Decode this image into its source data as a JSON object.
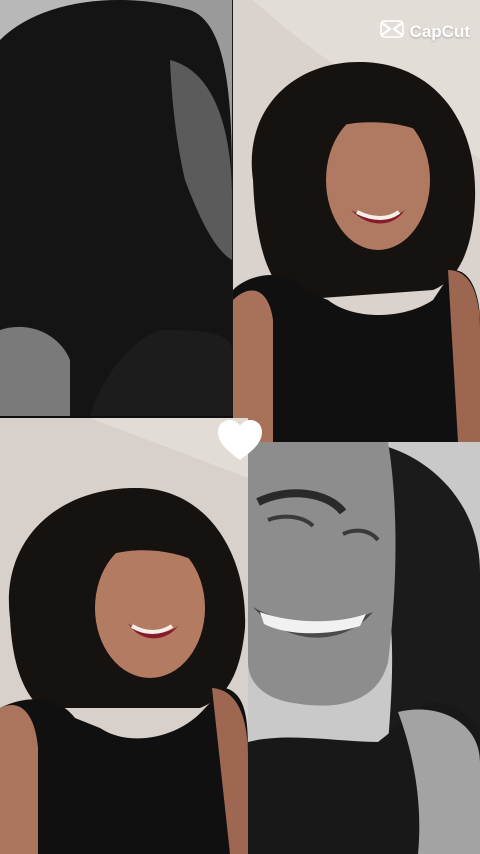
{
  "watermark": {
    "label": "CapCut",
    "icon": "capcut-logo-icon"
  },
  "tiles": [
    {
      "name": "photo-top-left",
      "tone": "grayscale"
    },
    {
      "name": "photo-top-right",
      "tone": "color"
    },
    {
      "name": "photo-bottom-left",
      "tone": "color"
    },
    {
      "name": "photo-bottom-right",
      "tone": "grayscale"
    }
  ],
  "decoration": {
    "icon": "heart-icon",
    "color": "#ffffff"
  },
  "colors": {
    "dark_hair": "#151210",
    "skin": "#b07a62",
    "lips": "#8a1a2a",
    "wall": "#d8d2cc"
  }
}
